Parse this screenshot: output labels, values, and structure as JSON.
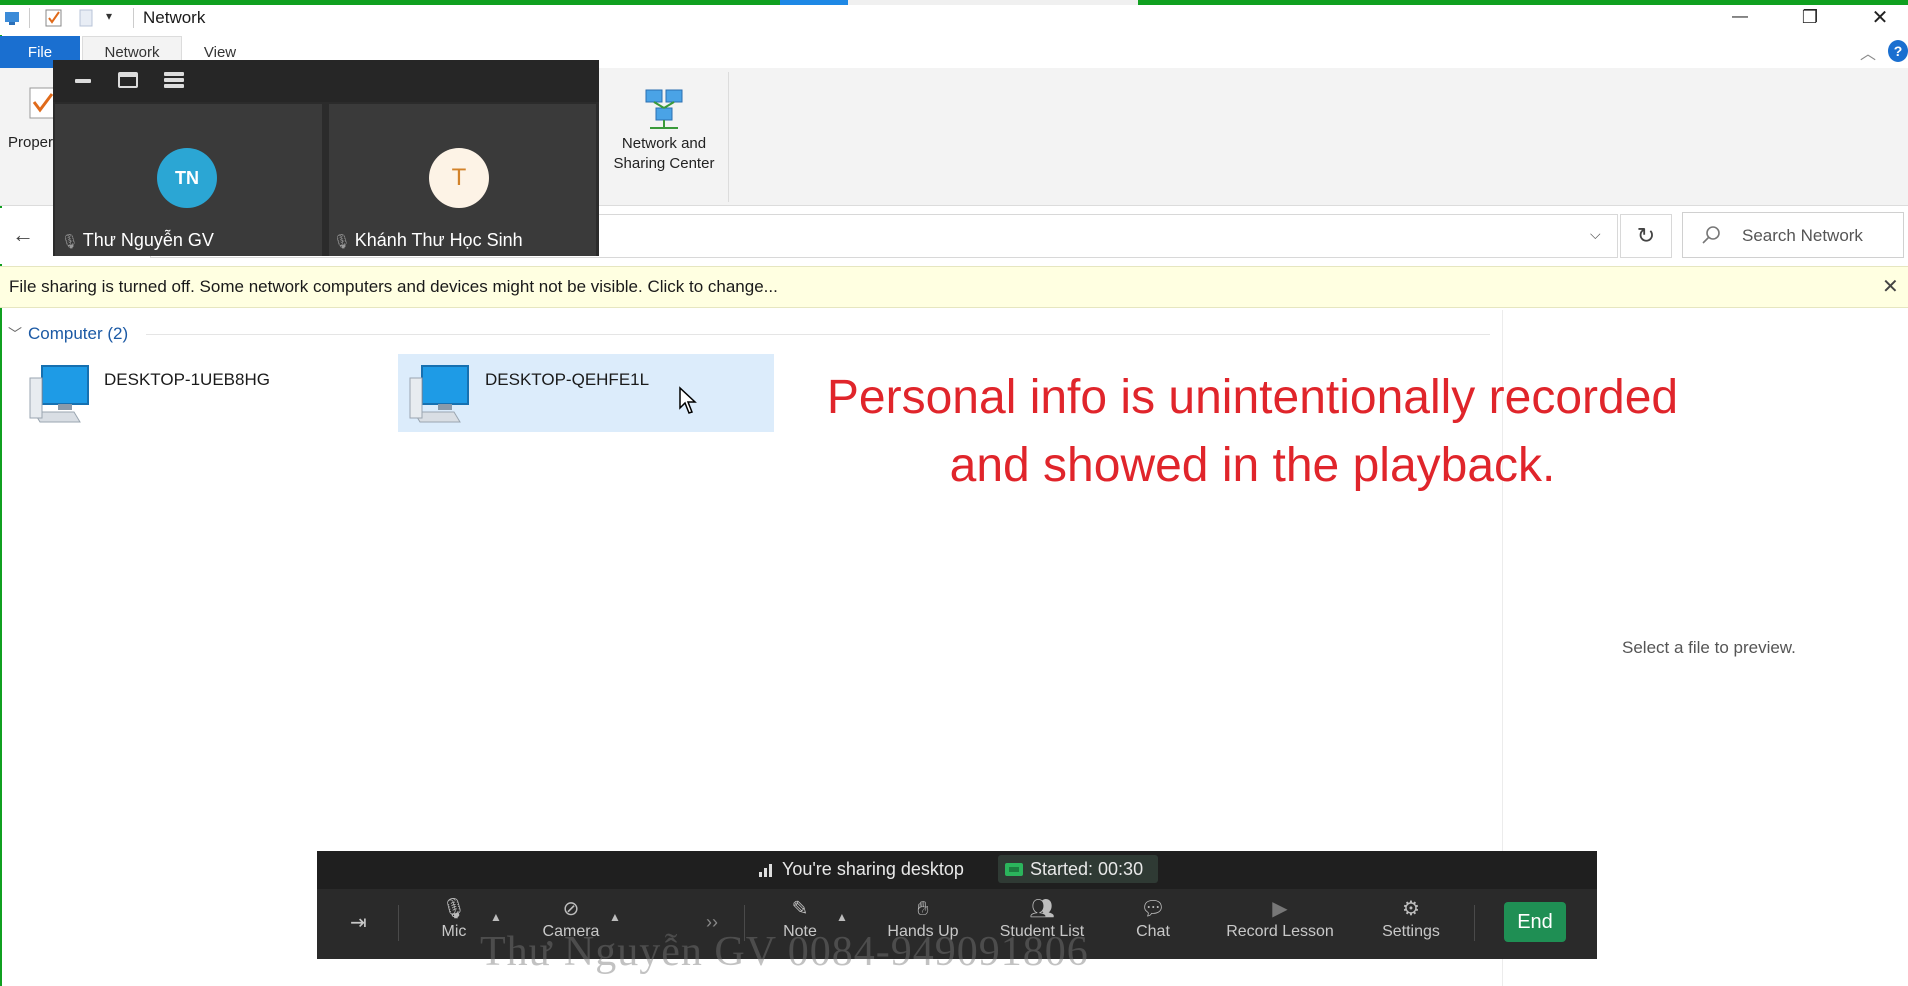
{
  "window": {
    "title": "Network",
    "minimize_glyph": "—",
    "restore_glyph": "❐",
    "close_glyph": "✕"
  },
  "ribbon": {
    "tabs": [
      {
        "label": "File"
      },
      {
        "label": "Network"
      },
      {
        "label": "View"
      }
    ],
    "properties_label": "Proper",
    "network_sharing_center_label_1": "Network and",
    "network_sharing_center_label_2": "Sharing Center"
  },
  "address": {
    "search_placeholder": "Search Network"
  },
  "infobar": {
    "text": "File sharing is turned off. Some network computers and devices might not be visible. Click to change..."
  },
  "content": {
    "group_label": "Computer (2)",
    "computers": [
      {
        "name": "DESKTOP-1UEB8HG",
        "selected": false
      },
      {
        "name": "DESKTOP-QEHFE1L",
        "selected": true
      }
    ],
    "preview_text": "Select a file to preview."
  },
  "annotation": {
    "line1": "Personal info is unintentionally recorded",
    "line2": "and showed in the playback."
  },
  "video_panel": {
    "participants": [
      {
        "initials": "TN",
        "name": "Thư Nguyễn GV",
        "avatar_bg": "#2ba6d4",
        "avatar_fg": "#ffffff"
      },
      {
        "initials": "T",
        "name": "Khánh Thư Học Sinh",
        "avatar_bg": "#fdf3e6",
        "avatar_fg": "#d2822a"
      }
    ]
  },
  "meeting_bar": {
    "sharing_text": "You're sharing desktop",
    "started_text": "Started: 00:30",
    "buttons": {
      "mic": "Mic",
      "camera": "Camera",
      "note": "Note",
      "hands_up": "Hands Up",
      "student_list": "Student List",
      "chat": "Chat",
      "record_lesson": "Record Lesson",
      "settings": "Settings",
      "end": "End"
    }
  },
  "watermark": "Thư Nguyễn GV 0084-949091806",
  "colors": {
    "accent_blue": "#1a6fd0",
    "annotation_red": "#e0252b",
    "end_green": "#1f8f54",
    "infobar_bg": "#ffffe1"
  }
}
